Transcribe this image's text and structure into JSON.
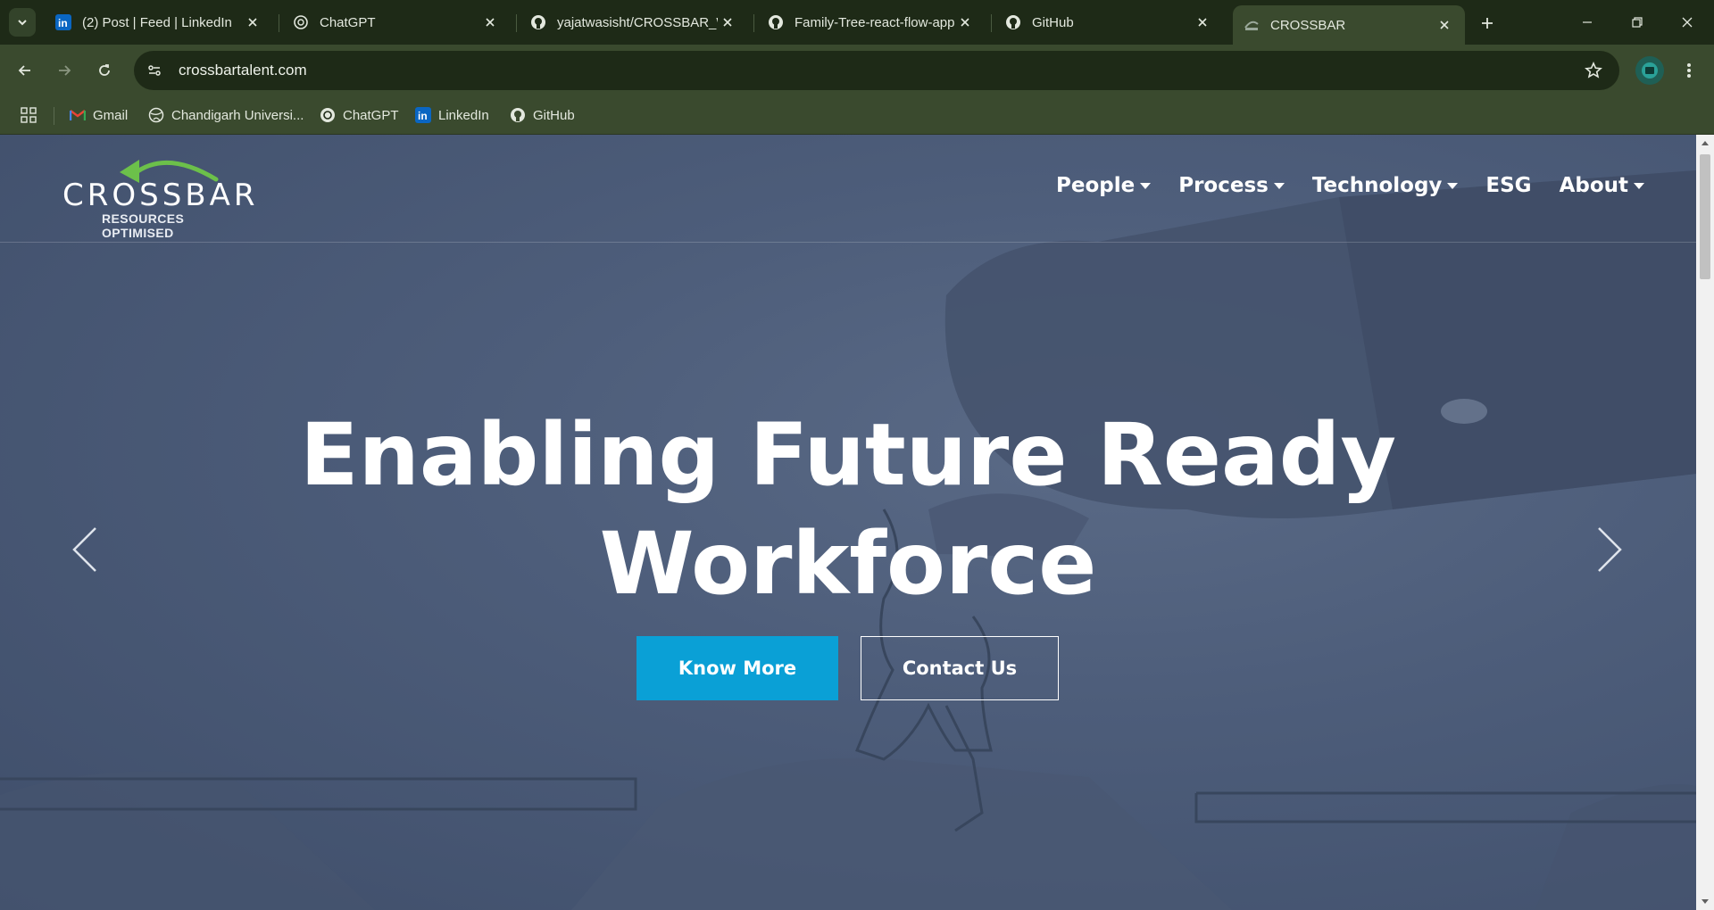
{
  "browser": {
    "tabs": [
      {
        "title": "(2) Post | Feed | LinkedIn",
        "icon": "linkedin-icon"
      },
      {
        "title": "ChatGPT",
        "icon": "chatgpt-icon"
      },
      {
        "title": "yajatwasisht/CROSSBAR_W",
        "icon": "github-icon"
      },
      {
        "title": "Family-Tree-react-flow-app",
        "icon": "github-icon"
      },
      {
        "title": "GitHub",
        "icon": "github-icon"
      },
      {
        "title": "CROSSBAR",
        "icon": "crossbar-icon"
      }
    ],
    "active_tab": "CROSSBAR",
    "url": "crossbartalent.com",
    "bookmarks": [
      {
        "label": "Gmail",
        "icon": "gmail-icon"
      },
      {
        "label": "Chandigarh Universi...",
        "icon": "globe-icon"
      },
      {
        "label": "ChatGPT",
        "icon": "chatgpt-icon"
      },
      {
        "label": "LinkedIn",
        "icon": "linkedin-icon"
      },
      {
        "label": "GitHub",
        "icon": "github-icon"
      }
    ]
  },
  "site": {
    "logo": {
      "word": "CROSSBAR",
      "tagline": "RESOURCES OPTIMISED"
    },
    "nav": [
      {
        "label": "People",
        "dropdown": true
      },
      {
        "label": "Process",
        "dropdown": true
      },
      {
        "label": "Technology",
        "dropdown": true
      },
      {
        "label": "ESG",
        "dropdown": false
      },
      {
        "label": "About",
        "dropdown": true
      }
    ],
    "hero": {
      "title_line1": "Enabling Future Ready",
      "title_line2": "Workforce",
      "primary_button": "Know More",
      "secondary_button": "Contact Us"
    }
  },
  "colors": {
    "browser_frame": "#3a4a2e",
    "tabstrip": "#1e2a17",
    "hero_overlay": "#4d5d7a",
    "primary_button": "#0aa0d6",
    "logo_arrow": "#6cc04a"
  }
}
